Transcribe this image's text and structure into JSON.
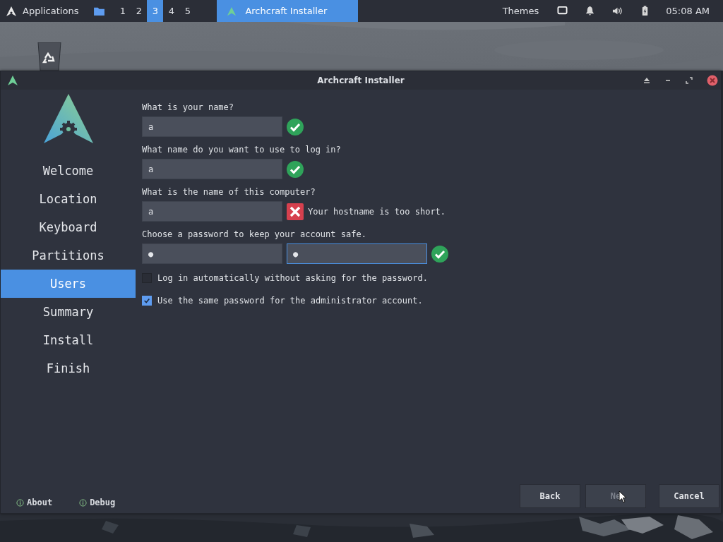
{
  "taskbar": {
    "menu_label": "Applications",
    "workspaces": [
      {
        "label": "1",
        "selected": false
      },
      {
        "label": "2",
        "selected": false
      },
      {
        "label": "3",
        "selected": true
      },
      {
        "label": "4",
        "selected": false
      },
      {
        "label": "5",
        "selected": false
      }
    ],
    "task": {
      "label": "Archcraft Installer",
      "selected": true
    },
    "themes": "Themes",
    "clock": "05:08 AM"
  },
  "window": {
    "title": "Archcraft Installer"
  },
  "sidebar": {
    "items": [
      {
        "label": "Welcome",
        "selected": false
      },
      {
        "label": "Location",
        "selected": false
      },
      {
        "label": "Keyboard",
        "selected": false
      },
      {
        "label": "Partitions",
        "selected": false
      },
      {
        "label": "Users",
        "selected": true
      },
      {
        "label": "Summary",
        "selected": false
      },
      {
        "label": "Install",
        "selected": false
      },
      {
        "label": "Finish",
        "selected": false
      }
    ],
    "links": [
      "About",
      "Debug"
    ]
  },
  "form": {
    "fields": [
      {
        "label": "What is your name?",
        "inputs": [
          {
            "value": "a",
            "focused": false
          }
        ],
        "valid": true
      },
      {
        "label": "What name do you want to use to log in?",
        "inputs": [
          {
            "value": "a",
            "focused": false
          }
        ],
        "valid": true
      },
      {
        "label": "What is the name of this computer?",
        "inputs": [
          {
            "value": "a",
            "focused": false
          }
        ],
        "valid": false,
        "message": "Your hostname is too short."
      },
      {
        "label": "Choose a password to keep your account safe.",
        "inputs": [
          {
            "value": "●",
            "focused": false
          },
          {
            "value": "●",
            "focused": true
          }
        ],
        "valid": true
      }
    ],
    "checkboxes": [
      {
        "label": "Log in automatically without asking for the password.",
        "checked": false
      },
      {
        "label": "Use the same password for the administrator account.",
        "checked": true
      }
    ]
  },
  "buttons": [
    {
      "label": "Back",
      "disabled": false
    },
    {
      "label": "Ne",
      "disabled": true
    },
    {
      "label": "Cancel",
      "disabled": false
    }
  ]
}
